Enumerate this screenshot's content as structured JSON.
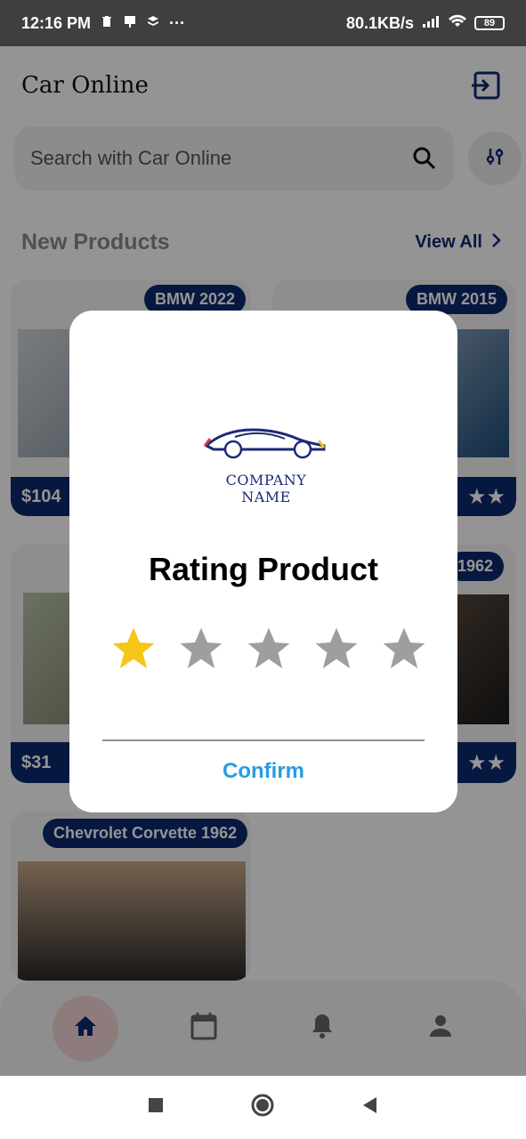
{
  "status_bar": {
    "time": "12:16 PM",
    "more": "···",
    "net_speed": "80.1KB/s",
    "battery": "89"
  },
  "app": {
    "title": "Car Online",
    "search_placeholder": "Search with Car Online",
    "section_title": "New Products",
    "view_all": "View All",
    "cards": [
      {
        "badge": "BMW 2022",
        "price": "$104"
      },
      {
        "badge": "BMW 2015"
      },
      {
        "price": "$31"
      },
      {
        "badge": "1962"
      },
      {
        "badge": "Chevrolet Corvette 1962"
      }
    ]
  },
  "modal": {
    "logo_text": "COMPANY NAME",
    "title": "Rating Product",
    "rating": 1,
    "max_rating": 5,
    "confirm": "Confirm"
  },
  "colors": {
    "navy": "#0d2a6e",
    "star_active": "#f5c518",
    "star_inactive": "#9e9e9e",
    "confirm": "#2a9be3"
  }
}
